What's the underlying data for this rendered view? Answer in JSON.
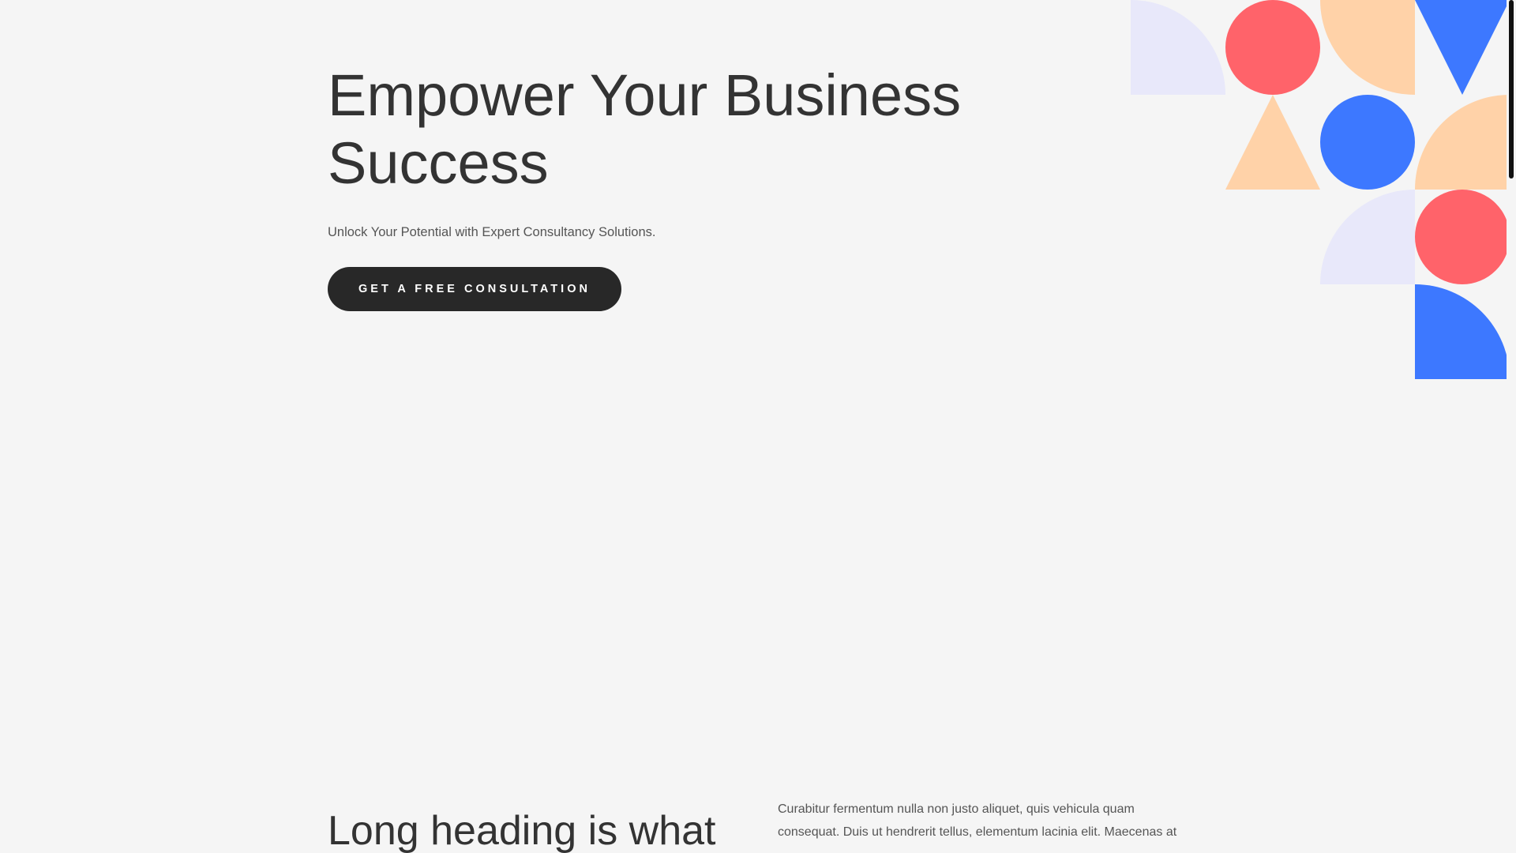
{
  "hero": {
    "title_line1": "Empower Your Business",
    "title_line2": "Success",
    "subtitle": "Unlock Your Potential with Expert Consultancy Solutions.",
    "cta_label": "GET A FREE CONSULTATION"
  },
  "section_two": {
    "heading": "Long heading is what",
    "body": "Curabitur fermentum nulla non justo aliquet, quis vehicula quam consequat. Duis ut hendrerit tellus, elementum lacinia elit. Maecenas at"
  },
  "colors": {
    "background": "#f5f5f5",
    "text": "#333333",
    "button": "#282828",
    "lavender": "#e8e8fa",
    "coral": "#ff636a",
    "peach": "#ffd2a8",
    "blue": "#3d78ff"
  }
}
